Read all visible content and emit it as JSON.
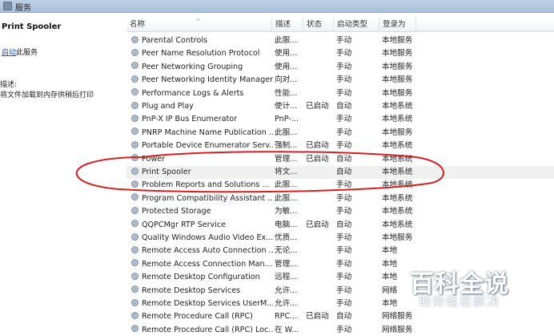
{
  "window": {
    "title": "服务"
  },
  "detail": {
    "service_name": "Print Spooler",
    "start_link": "启动",
    "start_suffix": "此服务",
    "description_label": "描述:",
    "description_text": "将文件加载到内存供稍后打印"
  },
  "columns": {
    "name": "名称",
    "desc": "描述",
    "state": "状态",
    "startup": "启动类型",
    "logon": "登录为"
  },
  "rows": [
    {
      "name": "Parental Controls",
      "desc": "此服...",
      "state": "",
      "startup": "手动",
      "logon": "本地服务"
    },
    {
      "name": "Peer Name Resolution Protocol",
      "desc": "使用...",
      "state": "",
      "startup": "手动",
      "logon": "本地服务"
    },
    {
      "name": "Peer Networking Grouping",
      "desc": "使用...",
      "state": "",
      "startup": "手动",
      "logon": "本地服务"
    },
    {
      "name": "Peer Networking Identity Manager",
      "desc": "向对...",
      "state": "",
      "startup": "手动",
      "logon": "本地服务"
    },
    {
      "name": "Performance Logs & Alerts",
      "desc": "性能...",
      "state": "",
      "startup": "手动",
      "logon": "本地服务"
    },
    {
      "name": "Plug and Play",
      "desc": "使计...",
      "state": "已启动",
      "startup": "自动",
      "logon": "本地系统"
    },
    {
      "name": "PnP-X IP Bus Enumerator",
      "desc": "PnP-...",
      "state": "",
      "startup": "手动",
      "logon": "本地系统"
    },
    {
      "name": "PNRP Machine Name Publication ...",
      "desc": "此服...",
      "state": "",
      "startup": "手动",
      "logon": "本地服务"
    },
    {
      "name": "Portable Device Enumerator Serv...",
      "desc": "强制...",
      "state": "已启动",
      "startup": "手动",
      "logon": "本地系统"
    },
    {
      "name": "Power",
      "desc": "管理...",
      "state": "已启动",
      "startup": "自动",
      "logon": "本地系统"
    },
    {
      "name": "Print Spooler",
      "desc": "将文...",
      "state": "",
      "startup": "自动",
      "logon": "本地系统"
    },
    {
      "name": "Problem Reports and Solutions ...",
      "desc": "此服...",
      "state": "",
      "startup": "手动",
      "logon": "本地系统"
    },
    {
      "name": "Program Compatibility Assistant ...",
      "desc": "此服...",
      "state": "",
      "startup": "手动",
      "logon": "本地系统"
    },
    {
      "name": "Protected Storage",
      "desc": "为敏...",
      "state": "",
      "startup": "手动",
      "logon": "本地系统"
    },
    {
      "name": "QQPCMgr RTP Service",
      "desc": "电脑...",
      "state": "已启动",
      "startup": "自动",
      "logon": "本地系统"
    },
    {
      "name": "Quality Windows Audio Video Ex...",
      "desc": "优质...",
      "state": "",
      "startup": "手动",
      "logon": "本地服务"
    },
    {
      "name": "Remote Access Auto Connection ...",
      "desc": "无论...",
      "state": "",
      "startup": "手动",
      "logon": "本地"
    },
    {
      "name": "Remote Access Connection Man...",
      "desc": "管理...",
      "state": "",
      "startup": "手动",
      "logon": "本地"
    },
    {
      "name": "Remote Desktop Configuration",
      "desc": "远程...",
      "state": "",
      "startup": "手动",
      "logon": "本地"
    },
    {
      "name": "Remote Desktop Services",
      "desc": "允许...",
      "state": "",
      "startup": "手动",
      "logon": "网络"
    },
    {
      "name": "Remote Desktop Services UserM...",
      "desc": "允许...",
      "state": "",
      "startup": "手动",
      "logon": "本地"
    },
    {
      "name": "Remote Procedure Call (RPC)",
      "desc": "RPC...",
      "state": "已启动",
      "startup": "自动",
      "logon": "网络服务"
    },
    {
      "name": "Remote Procedure Call (RPC) Loc...",
      "desc": "在 W...",
      "state": "",
      "startup": "手动",
      "logon": "网络服务"
    }
  ],
  "watermark": {
    "logo": "百科全说",
    "slogan": "助你轻松解决"
  },
  "colors": {
    "accent": "#1a56c8",
    "highlight_circle": "#d42020"
  },
  "icons": {
    "row_icon": "gear-icon"
  }
}
